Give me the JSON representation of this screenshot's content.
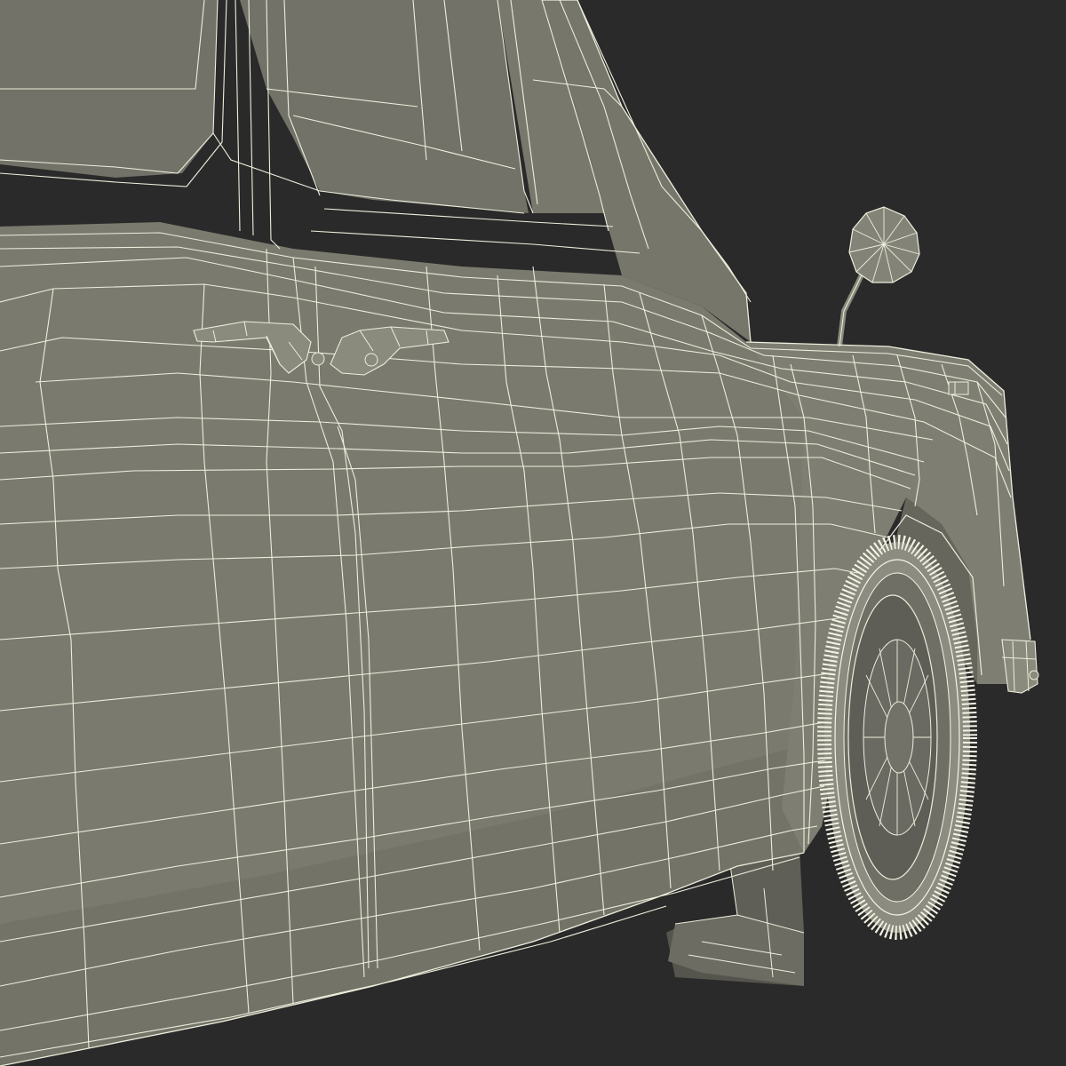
{
  "scene": {
    "subject": "car",
    "render_style": "wireframe",
    "colors": {
      "background": "#2a2a2a",
      "body_surface": "#7b7b6f",
      "body_dark": "#6a6a60",
      "window_surface": "#727268",
      "wire": "#eeeedd",
      "tyre_wire": "#f4f4e6",
      "underbody": "#5b5b54"
    },
    "parts": [
      "door-panel",
      "side-windows",
      "door-handle-rear",
      "door-handle-front",
      "front-fender",
      "wing-mirror",
      "front-wheel",
      "tyre",
      "hubcap",
      "bumper",
      "mud-flap",
      "indicator-lamp"
    ]
  }
}
